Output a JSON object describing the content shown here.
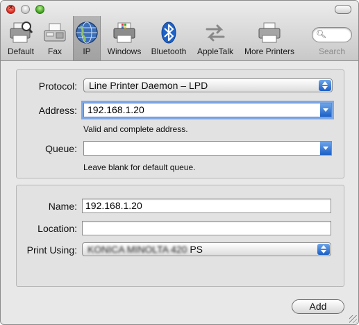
{
  "window": {
    "controls": {
      "close_glyph": "×"
    },
    "toolbar": {
      "items": [
        {
          "label": "Default",
          "icon": "default-printer-icon"
        },
        {
          "label": "Fax",
          "icon": "fax-icon"
        },
        {
          "label": "IP",
          "icon": "globe-icon",
          "selected": true
        },
        {
          "label": "Windows",
          "icon": "windows-printer-icon"
        },
        {
          "label": "Bluetooth",
          "icon": "bluetooth-icon"
        },
        {
          "label": "AppleTalk",
          "icon": "appletalk-icon"
        },
        {
          "label": "More Printers",
          "icon": "more-printers-icon"
        }
      ],
      "search": {
        "label": "Search",
        "icon": "search-icon",
        "value": ""
      }
    }
  },
  "connection": {
    "protocol": {
      "label": "Protocol:",
      "value": "Line Printer Daemon – LPD"
    },
    "address": {
      "label": "Address:",
      "value": "192.168.1.20",
      "note": "Valid and complete address."
    },
    "queue": {
      "label": "Queue:",
      "value": "",
      "note": "Leave blank for default queue."
    }
  },
  "details": {
    "name": {
      "label": "Name:",
      "value": "192.168.1.20"
    },
    "location": {
      "label": "Location:",
      "value": ""
    },
    "print_using": {
      "label": "Print Using:",
      "value_suffix": "PS",
      "value_blurred": "KONICA MINOLTA 420"
    }
  },
  "actions": {
    "add_label": "Add"
  },
  "colors": {
    "accent": "#2f6fd4",
    "window_bg": "#e8e8e8"
  }
}
